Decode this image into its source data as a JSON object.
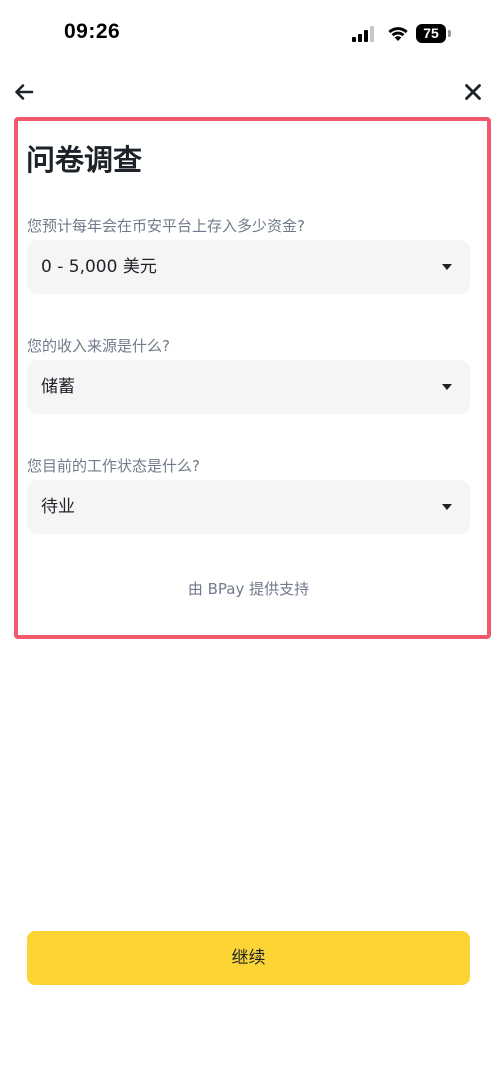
{
  "status_bar": {
    "time": "09:26",
    "battery": "75"
  },
  "nav": {
    "back_icon": "arrow-left-icon",
    "close_icon": "close-icon"
  },
  "survey": {
    "title": "问卷调查",
    "questions": [
      {
        "label": "您预计每年会在币安平台上存入多少资金?",
        "value": "0 - 5,000 美元"
      },
      {
        "label": "您的收入来源是什么?",
        "value": "储蓄"
      },
      {
        "label": "您目前的工作状态是什么?",
        "value": "待业"
      }
    ],
    "powered_by": "由 BPay 提供支持"
  },
  "footer": {
    "continue_label": "继续"
  },
  "colors": {
    "accent": "#fcd535",
    "highlight": "#f05a6a",
    "field_bg": "#f5f5f5",
    "muted_text": "#707a8a"
  }
}
